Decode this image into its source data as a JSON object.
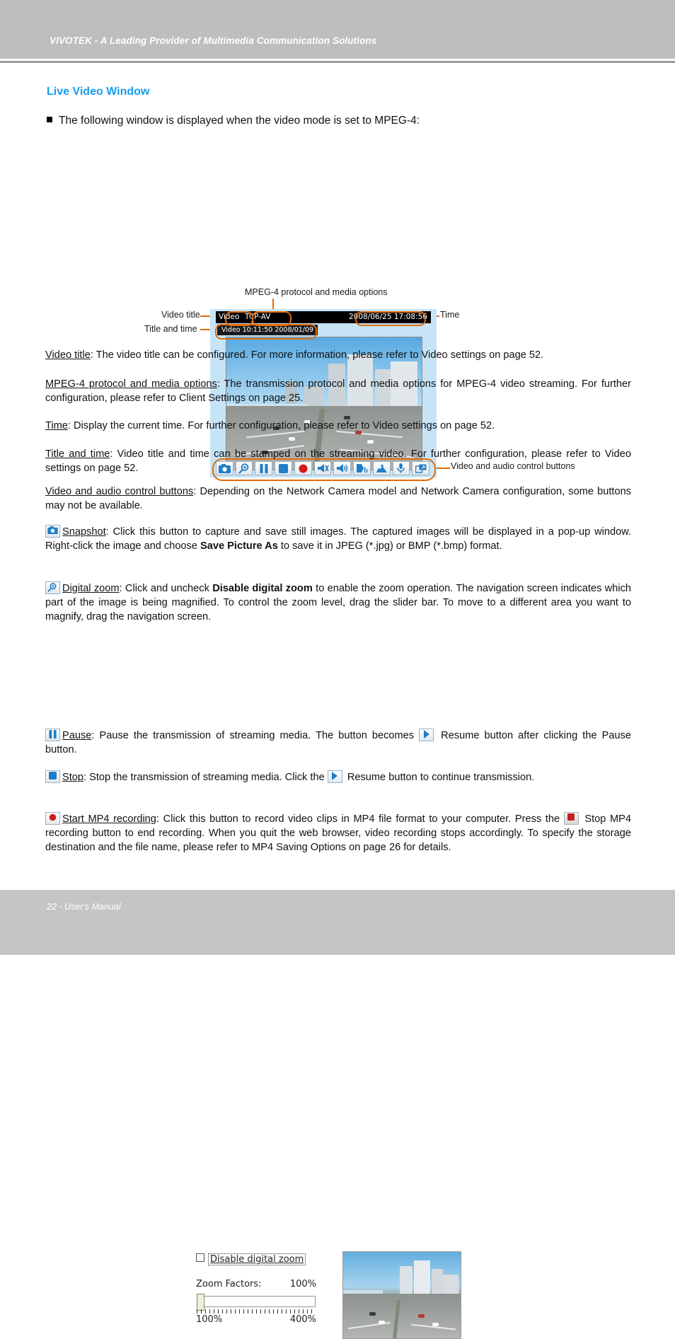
{
  "header": {
    "title": "VIVOTEK - A Leading Provider of Multimedia Communication Solutions"
  },
  "footer": {
    "text": "22 - User's Manual"
  },
  "section": {
    "title": "Live Video Window",
    "bullet": "The following window is displayed when the video mode is set to MPEG-4:"
  },
  "figure": {
    "callouts": {
      "mpeg": "MPEG-4 protocol and media options",
      "video_title": "Video title",
      "title_and_time": "Title and time",
      "time": "Time",
      "controls": "Video and audio control buttons"
    },
    "player": {
      "title": "Video",
      "protocol": "TCP-AV",
      "clock": "2008/06/25 17:08:56",
      "stamp": "Video 10:11:50  2008/01/09"
    },
    "buttons": [
      {
        "name": "snapshot-icon",
        "label": "Snapshot"
      },
      {
        "name": "digital-zoom-icon",
        "label": "Digital zoom"
      },
      {
        "name": "pause-icon",
        "label": "Pause"
      },
      {
        "name": "stop-icon",
        "label": "Stop"
      },
      {
        "name": "record-icon",
        "label": "Start MP4 recording"
      },
      {
        "name": "volume-mute-icon",
        "label": "Mute"
      },
      {
        "name": "speaker-icon",
        "label": "Volume"
      },
      {
        "name": "talk-icon",
        "label": "Talk"
      },
      {
        "name": "mic-mute-icon",
        "label": "Mic mute"
      },
      {
        "name": "microphone-icon",
        "label": "Microphone"
      },
      {
        "name": "fullscreen-icon",
        "label": "Full screen"
      }
    ]
  },
  "body": {
    "p_video_title_term": "Video title",
    "p_video_title": ": The video title can be configured. For more information, please refer to Video settings on page 52.",
    "p_mpeg_term": "MPEG-4 protocol and media options",
    "p_mpeg": ": The transmission protocol and media options for MPEG-4 video streaming. For further configuration, please refer to Client Settings on page 25.",
    "p_time_term": "Time",
    "p_time": ": Display the current time. For further configuration, please refer to Video settings on page 52.",
    "p_title_time_term": "Title and time",
    "p_title_time": ": Video title and time can be stamped on the streaming video. For further configuration, please refer to Video settings on page 52.",
    "p_controls_term": "Video and audio control buttons",
    "p_controls": ": Depending on the Network Camera model and Network Camera configuration, some buttons may not be available.",
    "p_snapshot_term": "Snapshot",
    "p_snapshot_a": ": Click this button to capture and save still images. The captured images will be displayed in a pop-up window. Right-click the image and choose ",
    "p_snapshot_bold": "Save Picture As",
    "p_snapshot_b": " to save it in JPEG (*.jpg) or BMP (*.bmp) format.",
    "p_zoom_term": "Digital zoom",
    "p_zoom_a": ": Click and uncheck ",
    "p_zoom_bold": "Disable digital zoom",
    "p_zoom_b": " to enable the zoom operation. The navigation screen indicates which part of the image is being magnified. To control the zoom level, drag the slider bar. To move to a different area you want to magnify, drag the navigation screen.",
    "p_pause_term": "Pause",
    "p_pause_a": ": Pause the transmission of streaming media. The button becomes ",
    "p_pause_b": " Resume button after clicking the Pause button.",
    "p_stop_term": "Stop",
    "p_stop_a": ": Stop the transmission of streaming media. Click the ",
    "p_stop_b": " Resume button to continue transmission.",
    "p_mp4_term": "Start MP4 recording",
    "p_mp4_a": ": Click this button to record video clips in MP4 file format to your computer. Press the ",
    "p_mp4_b": " Stop MP4 recording button to end recording. When you quit the web browser, video recording stops accordingly. To specify the storage destination and the file name, please refer to MP4 Saving Options on page 26 for details."
  },
  "zoom_dialog": {
    "checkbox_label": "Disable digital zoom",
    "checked": false,
    "factors_label": "Zoom Factors:",
    "factors_value": "100%",
    "range_min": "100%",
    "range_max": "400%",
    "slider_value": 100
  },
  "colors": {
    "header_bg": "#bcbfbe",
    "footer_bg": "#c3c6c5",
    "accent_title": "#159ceb",
    "callout_orange": "#e36c09",
    "panel_blue": "#c7e4f7"
  }
}
